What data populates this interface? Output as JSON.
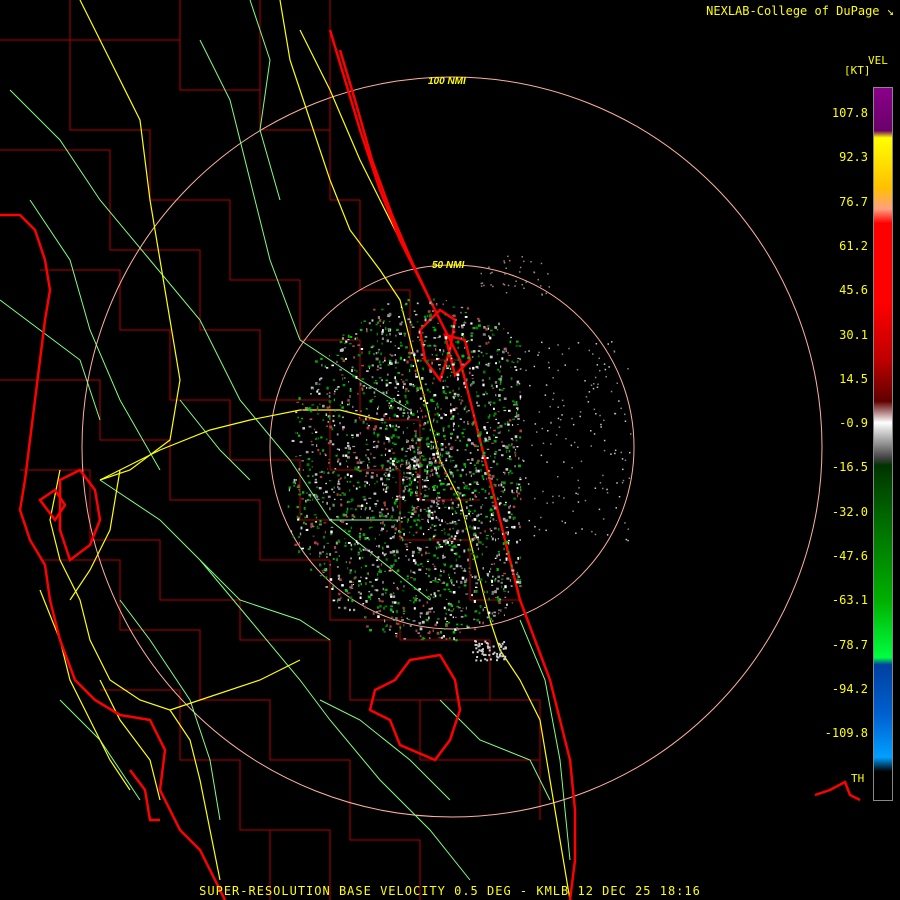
{
  "header": {
    "brand": "NEXLAB-College of DuPage"
  },
  "legend": {
    "product": "VEL",
    "unit": "[KT]",
    "values": [
      "107.8",
      "92.3",
      "76.7",
      "61.2",
      "45.6",
      "30.1",
      "14.5",
      "-0.9",
      "-16.5",
      "-32.0",
      "-47.6",
      "-63.1",
      "-78.7",
      "-94.2",
      "-109.8"
    ],
    "threshold": "TH"
  },
  "rings": {
    "inner": "50 NMI",
    "outer": "100 NMI"
  },
  "footer": {
    "caption": "SUPER-RESOLUTION BASE VELOCITY 0.5 DEG - KMLB 12 DEC 25 18:16"
  },
  "colors": {
    "background": "#000000",
    "coastline": "#ff0000",
    "county": "#b00000",
    "highway": "#ffff00",
    "road": "#80ff80",
    "ring": "#ffb0a0",
    "text": "#ffff00"
  },
  "icons": {
    "brand": "corner-logo-icon"
  }
}
